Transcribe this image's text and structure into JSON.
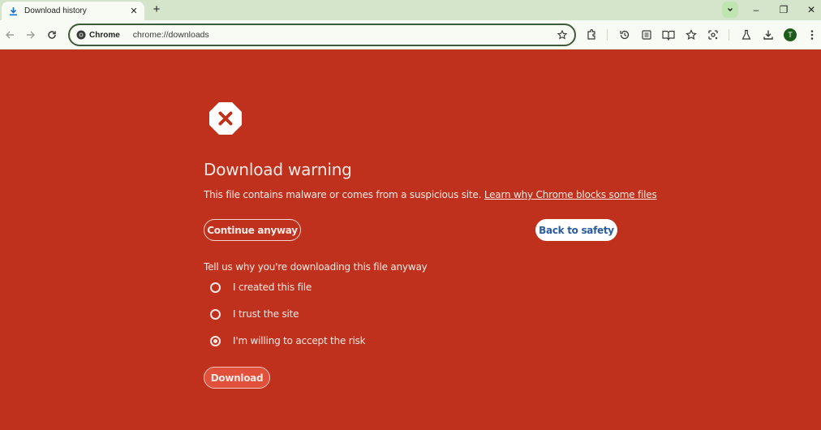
{
  "browser": {
    "tab": {
      "title": "Download history",
      "close_label": "✕"
    },
    "new_tab_label": "+",
    "window_controls": {
      "minimize": "–",
      "restore": "❐",
      "close": "✕"
    },
    "omnibox": {
      "chip_label": "Chrome",
      "url": "chrome://downloads"
    },
    "profile_initial": "T",
    "toolbar_icons": [
      "extensions-icon",
      "history-icon",
      "reading-mode-icon",
      "reading-list-icon",
      "bookmarks-icon",
      "lens-icon",
      "labs-icon",
      "downloads-icon",
      "menu-icon"
    ]
  },
  "page": {
    "title": "Download warning",
    "description": "This file contains malware or comes from a suspicious site.",
    "learn_more_link": "Learn why Chrome blocks some files",
    "continue_button": "Continue anyway",
    "safety_button": "Back to safety",
    "prompt": "Tell us why you're downloading this file anyway",
    "options": [
      {
        "label": "I created this file",
        "checked": false
      },
      {
        "label": "I trust the site",
        "checked": false
      },
      {
        "label": "I'm willing to accept the risk",
        "checked": true
      }
    ],
    "download_button": "Download"
  },
  "colors": {
    "page_background": "#bf311c",
    "safety_button_text": "#2a5c9c",
    "download_button_bg": "#e0503a",
    "tabstrip": "#d5e5cc"
  }
}
